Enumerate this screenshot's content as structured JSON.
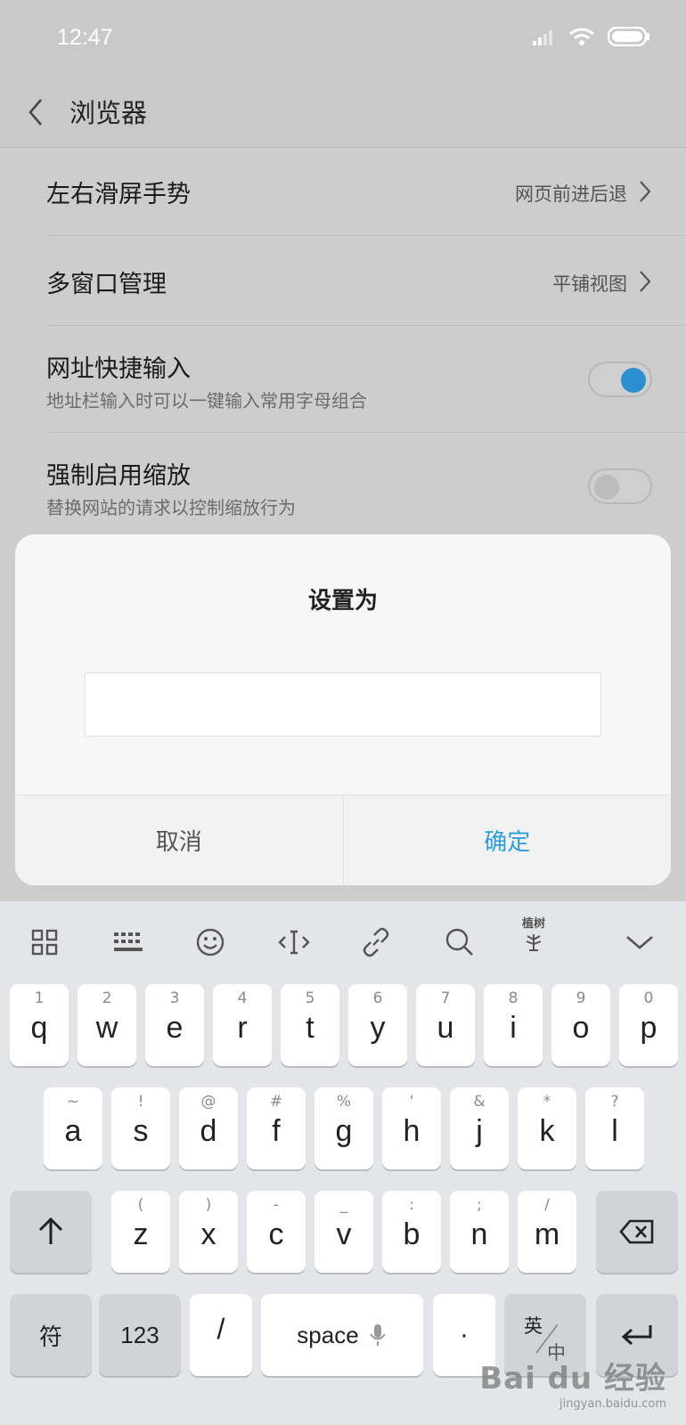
{
  "status_bar": {
    "time": "12:47"
  },
  "app_bar": {
    "title": "浏览器"
  },
  "settings": [
    {
      "title": "左右滑屏手势",
      "value": "网页前进后退"
    },
    {
      "title": "多窗口管理",
      "value": "平铺视图"
    },
    {
      "title": "网址快捷输入",
      "subtitle": "地址栏输入时可以一键输入常用字母组合",
      "toggle": "on"
    },
    {
      "title": "强制启用缩放",
      "subtitle": "替换网站的请求以控制缩放行为",
      "toggle": "off"
    }
  ],
  "dialog": {
    "title": "设置为",
    "input_value": "",
    "cancel_label": "取消",
    "ok_label": "确定"
  },
  "keyboard": {
    "toolbar_text": "植树",
    "row1": [
      {
        "hint": "1",
        "key": "q"
      },
      {
        "hint": "2",
        "key": "w"
      },
      {
        "hint": "3",
        "key": "e"
      },
      {
        "hint": "4",
        "key": "r"
      },
      {
        "hint": "5",
        "key": "t"
      },
      {
        "hint": "6",
        "key": "y"
      },
      {
        "hint": "7",
        "key": "u"
      },
      {
        "hint": "8",
        "key": "i"
      },
      {
        "hint": "9",
        "key": "o"
      },
      {
        "hint": "0",
        "key": "p"
      }
    ],
    "row2": [
      {
        "hint": "~",
        "key": "a"
      },
      {
        "hint": "!",
        "key": "s"
      },
      {
        "hint": "@",
        "key": "d"
      },
      {
        "hint": "#",
        "key": "f"
      },
      {
        "hint": "%",
        "key": "g"
      },
      {
        "hint": "'",
        "key": "h"
      },
      {
        "hint": "&",
        "key": "j"
      },
      {
        "hint": "*",
        "key": "k"
      },
      {
        "hint": "?",
        "key": "l"
      }
    ],
    "row3": [
      {
        "hint": "(",
        "key": "z"
      },
      {
        "hint": ")",
        "key": "x"
      },
      {
        "hint": "-",
        "key": "c"
      },
      {
        "hint": "_",
        "key": "v"
      },
      {
        "hint": ":",
        "key": "b"
      },
      {
        "hint": ";",
        "key": "n"
      },
      {
        "hint": "/",
        "key": "m"
      }
    ],
    "symbols_label": "符",
    "numbers_label": "123",
    "slash_label": "/",
    "space_label": "space",
    "dot_label": "·",
    "lang_top": "英",
    "lang_bottom": "中"
  },
  "watermark": {
    "brand": "Bai du 经验",
    "url": "jingyan.baidu.com"
  },
  "colors": {
    "accent": "#2f9fd8",
    "toggle_on": "#2b8fcf"
  }
}
